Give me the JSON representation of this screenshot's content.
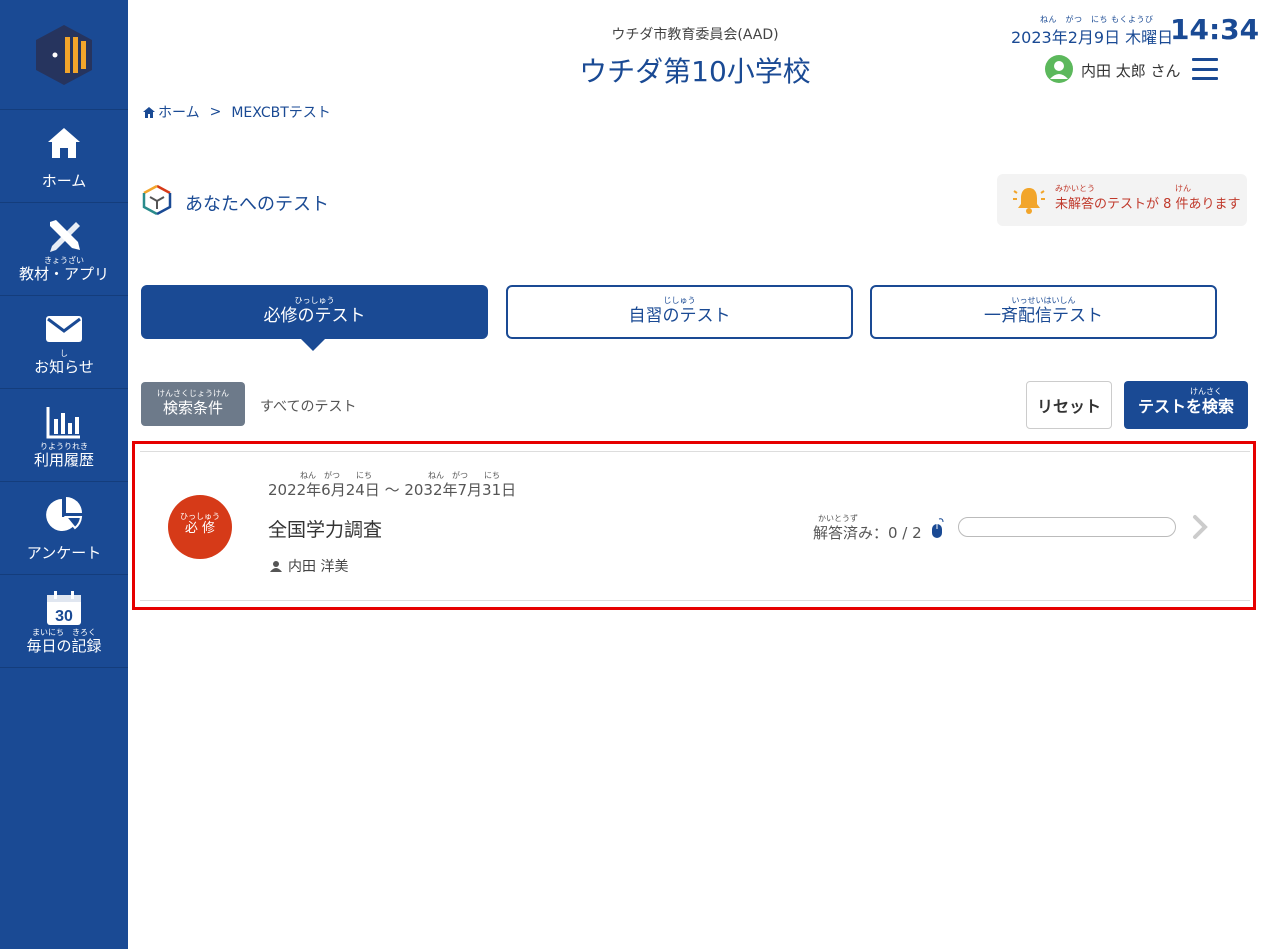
{
  "sidebar": {
    "items": [
      {
        "icon": "home-icon",
        "ruby": "",
        "label": "ホーム"
      },
      {
        "icon": "pencil-tools-icon",
        "ruby": "きょうざい",
        "label": "教材・アプリ"
      },
      {
        "icon": "envelope-icon",
        "ruby": "し",
        "label": "お知らせ"
      },
      {
        "icon": "bar-chart-icon",
        "ruby": "りようりれき",
        "label": "利用履歴"
      },
      {
        "icon": "pie-chart-icon",
        "ruby": "",
        "label": "アンケート"
      },
      {
        "icon": "calendar-icon",
        "ruby": "まいにち　きろく",
        "label": "毎日の記録",
        "calendar_day": "30"
      }
    ]
  },
  "header": {
    "subtitle": "ウチダ市教育委員会(AAD)",
    "title": "ウチダ第10小学校",
    "date_ruby": "ねん　がつ　にち もくようび",
    "date": "2023年2月9日 木曜日",
    "time": "14:34",
    "user_name": "内田 太郎 さん"
  },
  "breadcrumb": {
    "home": "ホーム",
    "separator": ">",
    "current": "MEXCBTテスト"
  },
  "section": {
    "title": "あなたへのテスト"
  },
  "alert": {
    "ruby": "みかいとう　　　　　　　　　　けん",
    "text": "未解答のテストが 8 件あります"
  },
  "tabs": [
    {
      "ruby": "ひっしゅう",
      "label": "必修のテスト",
      "active": true
    },
    {
      "ruby": "じしゅう",
      "label": "自習のテスト",
      "active": false
    },
    {
      "ruby": "いっせいはいしん",
      "label": "一斉配信テスト",
      "active": false
    }
  ],
  "filter": {
    "condition_ruby": "けんさくじょうけん",
    "condition_label": "検索条件",
    "condition_value": "すべてのテスト",
    "reset_label": "リセット",
    "search_ruby": "けんさく",
    "search_label": "テストを検索"
  },
  "test_card": {
    "badge_ruby": "ひっしゅう",
    "badge_label": "必 修",
    "date_ruby": "ねん　がつ　　にち　　　　　　　ねん　がつ　　にち",
    "date_range": "2022年6月24日 〜 2032年7月31日",
    "title": "全国学力調査",
    "author": "内田 洋美",
    "answered_ruby": "かいとうず",
    "answered": "解答済み：0 / 2",
    "progress": 0
  },
  "colors": {
    "primary": "#1a4a94",
    "badge": "#d63a18",
    "highlight": "#e60000",
    "alert_text": "#c0392b"
  }
}
